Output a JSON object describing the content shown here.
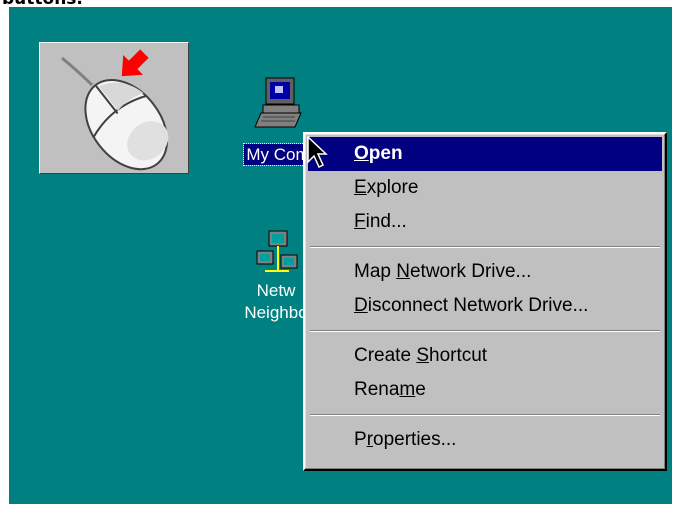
{
  "caption": "buttons.",
  "desktop": {
    "icons": [
      {
        "label": "My Computer",
        "visible_label": "My Com",
        "icon": "my-computer-icon"
      },
      {
        "label_line1": "Netw",
        "label_line2": "Neighbo",
        "icon": "network-neighborhood-icon"
      }
    ],
    "mouse_illustration_icon": "mouse-right-click-icon"
  },
  "context_menu": {
    "groups": [
      [
        {
          "label": "Open",
          "mnemonic": "O",
          "rest": "pen",
          "default": true,
          "selected": true
        },
        {
          "label": "Explore",
          "mnemonic": "E",
          "rest": "xplore"
        },
        {
          "label": "Find...",
          "mnemonic": "F",
          "rest": "ind..."
        }
      ],
      [
        {
          "label": "Map Network Drive...",
          "pre": "Map ",
          "mnemonic": "N",
          "rest": "etwork Drive..."
        },
        {
          "label": "Disconnect Network Drive...",
          "mnemonic": "D",
          "rest": "isconnect Network Drive..."
        }
      ],
      [
        {
          "label": "Create Shortcut",
          "pre": "Create ",
          "mnemonic": "S",
          "rest": "hortcut"
        },
        {
          "label": "Rename",
          "pre": "Rena",
          "mnemonic": "m",
          "rest": "e"
        }
      ],
      [
        {
          "label": "Properties...",
          "pre": "P",
          "mnemonic": "r",
          "rest": "operties..."
        }
      ]
    ]
  },
  "colors": {
    "desktop": "#008080",
    "menu_face": "#c0c0c0",
    "highlight": "#000080"
  }
}
